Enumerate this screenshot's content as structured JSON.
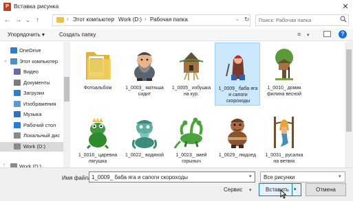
{
  "window": {
    "title": "Вставка рисунка",
    "close_symbol": "✕"
  },
  "nav_buttons": {
    "back": "←",
    "forward": "→",
    "recent": "⌄",
    "up": "↑"
  },
  "address": {
    "crumbs": [
      "Этот компьютер",
      "Work (D:)",
      "Рабочая папка"
    ],
    "separator": "›",
    "dropdown": "⌄",
    "refresh": "↻"
  },
  "search": {
    "placeholder": "Поиск: Рабочая папка",
    "icon": "search-icon"
  },
  "toolbar": {
    "organize": "Упорядочить ▾",
    "new_folder": "Создать папку",
    "view_icon": "≡",
    "view_dd": "▾",
    "help": "?"
  },
  "nav_pane": [
    {
      "label": "OneDrive",
      "icon": "cloud-icon",
      "color": "#2b7cd3",
      "level": 0,
      "arrow": ""
    },
    {
      "label": "Этот компьютер",
      "icon": "computer-icon",
      "color": "#4a90c8",
      "level": 0,
      "arrow": "⌄"
    },
    {
      "label": "Видео",
      "icon": "video-icon",
      "color": "#6b6b9e",
      "level": 1,
      "arrow": ""
    },
    {
      "label": "Документы",
      "icon": "documents-icon",
      "color": "#7c7c7c",
      "level": 1,
      "arrow": ""
    },
    {
      "label": "Загрузки",
      "icon": "downloads-icon",
      "color": "#2b7cd3",
      "level": 1,
      "arrow": ""
    },
    {
      "label": "Изображения",
      "icon": "pictures-icon",
      "color": "#5a9bd5",
      "level": 1,
      "arrow": ""
    },
    {
      "label": "Музыка",
      "icon": "music-icon",
      "color": "#3a6fb0",
      "level": 1,
      "arrow": ""
    },
    {
      "label": "Рабочий стол",
      "icon": "desktop-icon",
      "color": "#2b7cd3",
      "level": 1,
      "arrow": ""
    },
    {
      "label": "Локальный дис",
      "icon": "drive-icon",
      "color": "#8a8a8a",
      "level": 1,
      "arrow": ""
    },
    {
      "label": "Work (D:)",
      "icon": "drive-icon",
      "color": "#8a8a8a",
      "level": 1,
      "arrow": "",
      "selected": true
    },
    {
      "label": "Work (D:)",
      "icon": "drive-icon",
      "color": "#8a8a8a",
      "level": 0,
      "arrow": "›"
    }
  ],
  "files": [
    {
      "label": "Фотоальбом",
      "icon": "folder-icon",
      "art": "folder"
    },
    {
      "label": "1_0003_ матюша сидит",
      "icon": "dwarf-sitting-icon",
      "art": "dwarf"
    },
    {
      "label": "1_0005_ избушка на кур.",
      "icon": "hut-icon",
      "art": "hut"
    },
    {
      "label": "1_0009_ баба яга и сапоги скороходы",
      "icon": "baba-yaga-icon",
      "art": "witch",
      "selected": true
    },
    {
      "label": "1_0010_ домик филина весной",
      "icon": "treehouse-icon",
      "art": "tree"
    },
    {
      "label": "1_0016_ царевна лягушка",
      "icon": "frog-princess-icon",
      "art": "frog"
    },
    {
      "label": "1_0022_ водяной",
      "icon": "water-spirit-icon",
      "art": "vodyanoy"
    },
    {
      "label": "1_0023_ змей горыныч",
      "icon": "dragon-icon",
      "art": "dragon"
    },
    {
      "label": "1_0029_ людоед",
      "icon": "ogre-icon",
      "art": "ogre"
    },
    {
      "label": "1_0031_ русалка на ветвях",
      "icon": "mermaid-icon",
      "art": "mermaid"
    }
  ],
  "bottom": {
    "filename_label": "Имя файла:",
    "filename_value": "1_0009_ баба яга и сапоги скороходы",
    "filter_value": "Все рисунки",
    "service": "Сервис",
    "insert": "Вставить",
    "cancel": "Отмена",
    "dd": "▾"
  },
  "colors": {
    "selection": "#cce8ff",
    "accent": "#0078d7",
    "help": "#1b6fd1"
  }
}
